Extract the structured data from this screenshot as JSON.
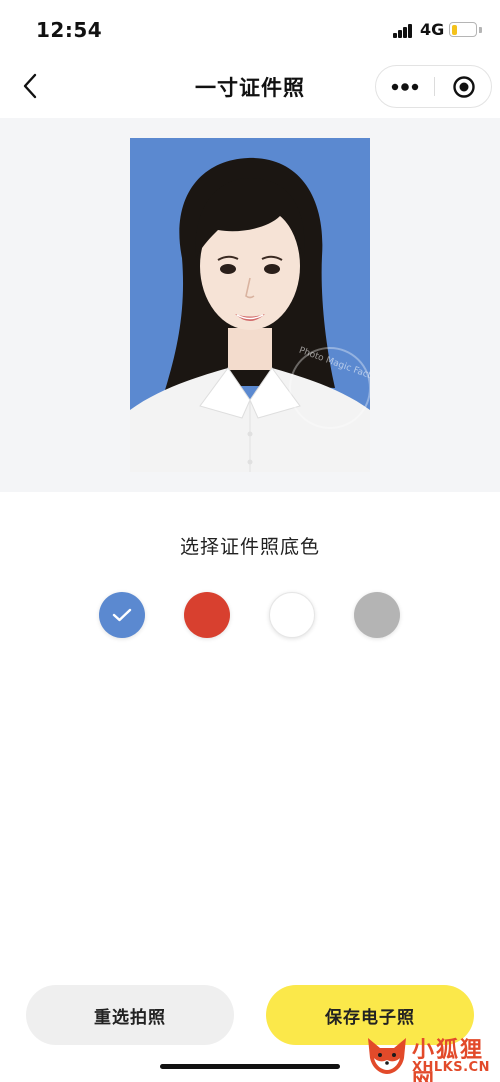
{
  "status_bar": {
    "time": "12:54",
    "network": "4G",
    "battery_level": 0.2
  },
  "nav": {
    "title": "一寸证件照",
    "icons": [
      "back-chevron-icon",
      "more-icon",
      "close-target-icon"
    ]
  },
  "photo": {
    "background_color": "#5b89d0",
    "watermark_text": "Photo Magic Factory"
  },
  "color_picker": {
    "title": "选择证件照底色",
    "options": [
      {
        "name": "blue",
        "color": "#5b89d0",
        "selected": true
      },
      {
        "name": "red",
        "color": "#d8402f",
        "selected": false
      },
      {
        "name": "white",
        "color": "#ffffff",
        "selected": false
      },
      {
        "name": "gray",
        "color": "#b4b4b4",
        "selected": false
      }
    ]
  },
  "actions": {
    "retake_label": "重选拍照",
    "save_label": "保存电子照"
  },
  "watermark": {
    "title": "小狐狸网",
    "url": "XHLKS.CN"
  }
}
